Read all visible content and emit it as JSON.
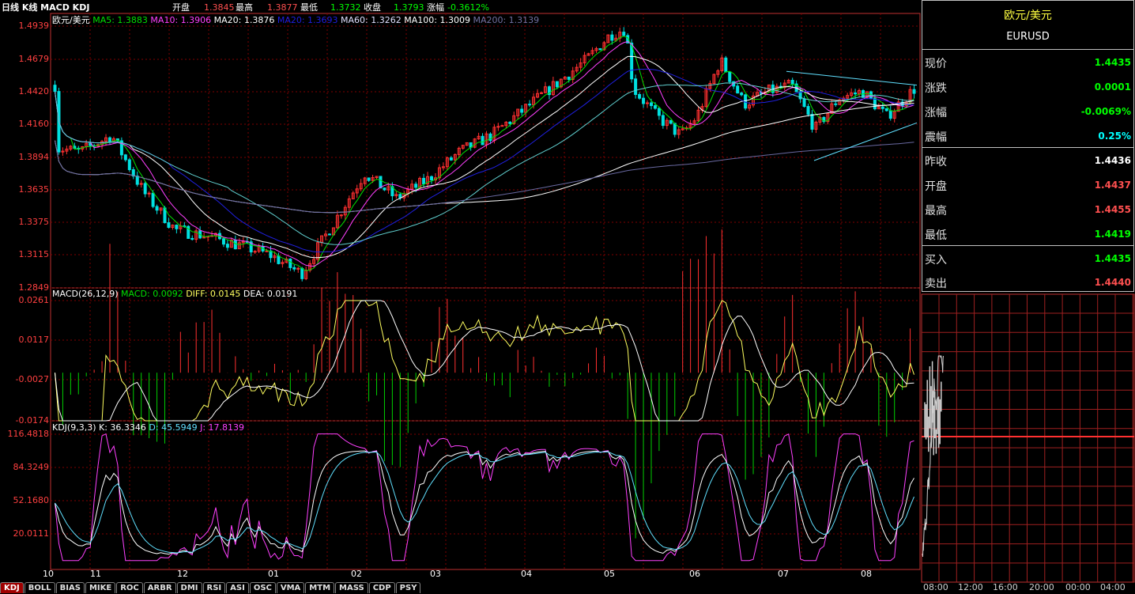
{
  "header": {
    "title": "日线 K线 MACD KDJ",
    "open_label": "开盘",
    "open": "1.3845",
    "high_label": "最高",
    "high": "1.3877",
    "low_label": "最低",
    "low": "1.3732",
    "close_label": "收盘",
    "close": "1.3793",
    "change_label": "涨幅",
    "change": "-0.3612%"
  },
  "ma_legend": {
    "name": "欧元/美元",
    "items": [
      {
        "text": "MA5: 1.3883",
        "color": "#00e000"
      },
      {
        "text": "MA10: 1.3906",
        "color": "#ff40ff"
      },
      {
        "text": "MA20: 1.3876",
        "color": "#ffffff"
      },
      {
        "text": "MA20: 1.3693",
        "color": "#1e1ee0"
      },
      {
        "text": "MA60: 1.3262",
        "color": "#e0e0ff"
      },
      {
        "text": "MA100: 1.3009",
        "color": "#ffffff"
      },
      {
        "text": "MA200: 1.3139",
        "color": "#7070a0"
      }
    ]
  },
  "macd_legend": {
    "name": "MACD(26,12,9)",
    "items": [
      {
        "text": "MACD: 0.0092",
        "color": "#00e000"
      },
      {
        "text": "DIFF: 0.0145",
        "color": "#ffff60"
      },
      {
        "text": "DEA: 0.0191",
        "color": "#ffffff"
      }
    ]
  },
  "kdj_legend": {
    "name": "KDJ(9,3,3)",
    "items": [
      {
        "text": "K: 36.3346",
        "color": "#ffffff"
      },
      {
        "text": "D: 45.5949",
        "color": "#60e0ff"
      },
      {
        "text": "J: 17.8139",
        "color": "#ff40ff"
      }
    ]
  },
  "price_axis": [
    "1.4939",
    "1.4679",
    "1.4420",
    "1.4160",
    "1.3894",
    "1.3635",
    "1.3375",
    "1.3115",
    "1.2849"
  ],
  "macd_axis": [
    "0.0261",
    "0.0117",
    "-0.0027",
    "-0.0174"
  ],
  "kdj_axis": [
    "116.4818",
    "84.3249",
    "52.1680",
    "20.0111"
  ],
  "months": [
    "10",
    "11",
    "12",
    "01",
    "02",
    "03",
    "04",
    "05",
    "06",
    "07",
    "08"
  ],
  "quote": {
    "name": "欧元/美元",
    "code": "EURUSD",
    "rows": [
      {
        "label": "现价",
        "value": "1.4435",
        "color": "#00ff00"
      },
      {
        "label": "涨跌",
        "value": "0.0001",
        "color": "#00ff00"
      },
      {
        "label": "涨幅",
        "value": "-0.0069%",
        "color": "#00ff00"
      },
      {
        "label": "震幅",
        "value": "0.25%",
        "color": "#00ffff"
      },
      {
        "label": "昨收",
        "value": "1.4436",
        "color": "#ffffff"
      },
      {
        "label": "开盘",
        "value": "1.4437",
        "color": "#ff5050"
      },
      {
        "label": "最高",
        "value": "1.4455",
        "color": "#ff5050"
      },
      {
        "label": "最低",
        "value": "1.4419",
        "color": "#00ff00"
      },
      {
        "label": "买入",
        "value": "1.4435",
        "color": "#00ff00"
      },
      {
        "label": "卖出",
        "value": "1.4440",
        "color": "#ff5050"
      }
    ]
  },
  "time_axis": [
    "08:00",
    "12:00",
    "16:00",
    "20:00",
    "00:00",
    "04:00"
  ],
  "tabs": [
    "KDJ",
    "BOLL",
    "BIAS",
    "MIKE",
    "ROC",
    "ARBR",
    "DMI",
    "RSI",
    "ASI",
    "OSC",
    "VMA",
    "MTM",
    "MASS",
    "CDP",
    "PSY"
  ],
  "colors": {
    "up": "#ff3030",
    "down": "#00e0e0",
    "grid": "#800000",
    "border": "#c03030"
  }
}
